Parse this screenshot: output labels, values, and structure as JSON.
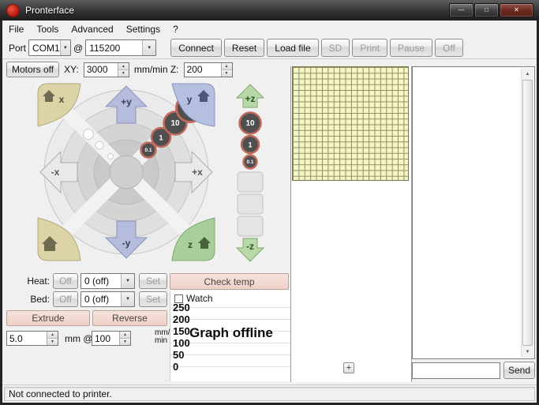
{
  "colors": {
    "titlebar": "#333333",
    "accent_pink": "#eed1c8",
    "bed_grid_fill": "#f6f5c6",
    "bed_grid_line": "#8f8f63",
    "jog_y_arrow": "#b6bcdc",
    "jog_x_arrow": "#e9e9e9",
    "jog_z_arrow": "#b9d8a8",
    "home_tan": "#dcd4a6",
    "home_blue": "#b5bfe0",
    "home_green": "#a8cf9b",
    "step_badge": "#4f4f4f",
    "step_badge_ring": "#c06a5c"
  },
  "titlebar": {
    "title": "Pronterface"
  },
  "icons": {
    "minimize": "—",
    "maximize": "□",
    "close": "✕",
    "dropdown": "▼",
    "spin_up": "▲",
    "spin_down": "▼",
    "scroll_up": "▲",
    "scroll_down": "▼",
    "zoom_in": "+"
  },
  "menu": {
    "items": [
      "File",
      "Tools",
      "Advanced",
      "Settings",
      "?"
    ]
  },
  "toolbar": {
    "port_label": "Port",
    "port_value": "COM1",
    "at_label": "@",
    "baud_value": "115200",
    "connect": "Connect",
    "reset": "Reset",
    "load_file": "Load file",
    "sd": "SD",
    "print": "Print",
    "pause": "Pause",
    "off": "Off"
  },
  "motion": {
    "motors_off": "Motors off",
    "xy_label": "XY:",
    "xy_feedrate": "3000",
    "z_label": "mm/min Z:",
    "z_feedrate": "200"
  },
  "jog": {
    "plus_y": "+y",
    "minus_y": "-y",
    "plus_x": "+x",
    "minus_x": "-x",
    "plus_z": "+z",
    "minus_z": "-z",
    "home_x_label": "x",
    "home_y_label": "y",
    "home_z_label": "z",
    "xy_distances": [
      "100",
      "10",
      "1",
      "0.1"
    ],
    "z_distances": [
      "10",
      "1",
      "0.1"
    ]
  },
  "heater": {
    "label": "Heat:",
    "off": "Off",
    "value": "0 (off)",
    "set": "Set"
  },
  "bed": {
    "label": "Bed:",
    "off": "Off",
    "value": "0 (off)",
    "set": "Set"
  },
  "monitor": {
    "check_temp": "Check temp",
    "watch": "Watch"
  },
  "graph": {
    "ticks": [
      "250",
      "200",
      "150",
      "100",
      "50",
      "0"
    ],
    "message": "Graph offline"
  },
  "extruder": {
    "extrude": "Extrude",
    "reverse": "Reverse",
    "length_value": "5.0",
    "mm_at_label": "mm @",
    "speed_value": "100",
    "unit_top": "mm/",
    "unit_bottom": "min"
  },
  "console": {
    "input_value": "",
    "send": "Send"
  },
  "statusbar": {
    "text": "Not connected to printer."
  }
}
